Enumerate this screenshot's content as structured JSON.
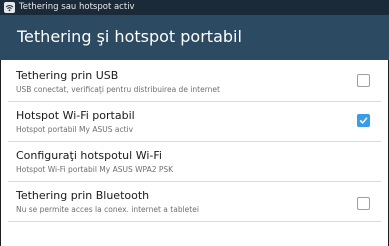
{
  "statusbar": {
    "text": "Tethering sau hotspot activ",
    "icon": "wifi-icon"
  },
  "header": {
    "title": "Tethering şi hotspot portabil"
  },
  "settings": [
    {
      "title": "Tethering prin USB",
      "subtitle": "USB conectat, verificaţi pentru distribuirea de internet",
      "checked": false
    },
    {
      "title": "Hotspot Wi-Fi portabil",
      "subtitle": "Hotspot portabil My ASUS activ",
      "checked": true
    },
    {
      "title": "Configuraţi hotspotul Wi-Fi",
      "subtitle": "Hotspot Wi-Fi portabil My ASUS WPA2 PSK"
    },
    {
      "title": "Tethering prin Bluetooth",
      "subtitle": "Nu se permite acces la conex. internet a tabletei",
      "checked": false
    }
  ],
  "colors": {
    "statusbar": "#1b2a38",
    "actionbar": "#2c4a61",
    "checkbox_checked": "#3a9be8"
  }
}
